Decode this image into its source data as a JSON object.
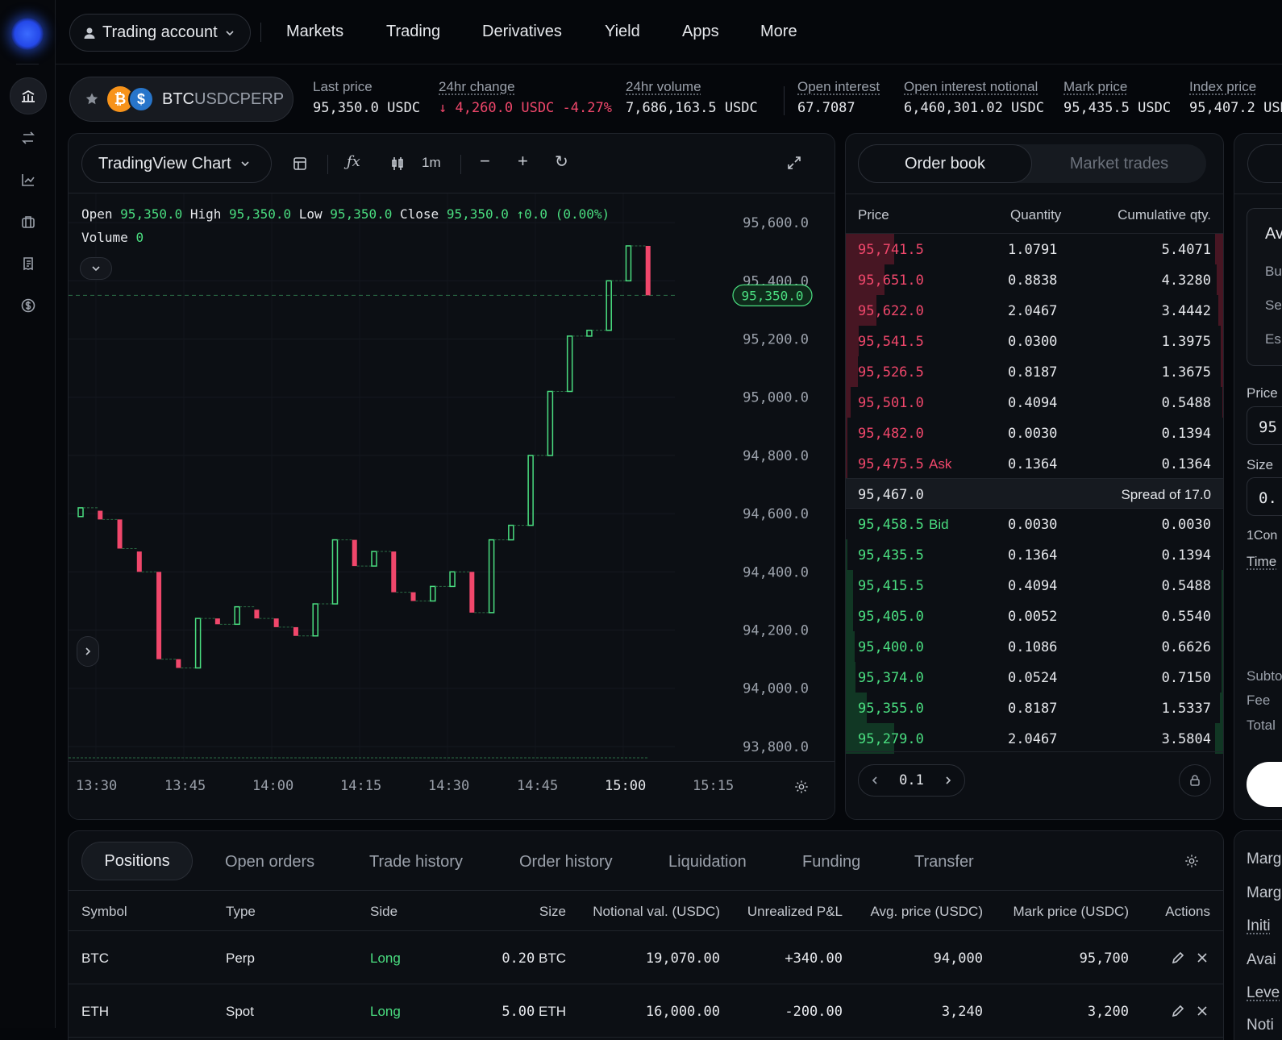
{
  "sidebar": {
    "icons": [
      "home-chart-icon",
      "swap-icon",
      "trend-icon",
      "briefcase-icon",
      "receipt-icon",
      "dollar-icon"
    ]
  },
  "nav": {
    "account": "Trading account",
    "items": [
      "Markets",
      "Trading",
      "Derivatives",
      "Yield",
      "Apps",
      "More"
    ]
  },
  "ticker": {
    "symbol_base": "BTC",
    "symbol_quote": "USDCPERP",
    "stats": [
      {
        "label": "Last price",
        "value": "95,350.0 USDC",
        "underline": false
      },
      {
        "label": "24hr change",
        "value": "↓ 4,260.0 USDC  -4.27%",
        "underline": true
      },
      {
        "label": "24hr volume",
        "value": "7,686,163.5 USDC",
        "underline": true
      },
      {
        "label": "Open interest",
        "value": "67.7087",
        "underline": true
      },
      {
        "label": "Open interest notional",
        "value": "6,460,301.02 USDC",
        "underline": true
      },
      {
        "label": "Mark price",
        "value": "95,435.5 USDC",
        "underline": true
      },
      {
        "label": "Index price",
        "value": "95,407.2 USDC",
        "underline": true
      }
    ]
  },
  "chart": {
    "selector": "TradingView Chart",
    "interval": "1m",
    "ohlc": {
      "open_label": "Open",
      "open": "95,350.0",
      "high_label": "High",
      "high": "95,350.0",
      "low_label": "Low",
      "low": "95,350.0",
      "close_label": "Close",
      "close": "95,350.0",
      "change": "↑0.0 (0.00%)"
    },
    "volume_label": "Volume",
    "volume": "0",
    "current_price_tag": "95,350.0",
    "time_labels": [
      "13:30",
      "13:45",
      "14:00",
      "14:15",
      "14:30",
      "14:45",
      "15:00",
      "15:15"
    ],
    "price_labels": [
      "95,600.0",
      "95,400.0",
      "95,200.0",
      "95,000.0",
      "94,800.0",
      "94,600.0",
      "94,400.0",
      "94,200.0",
      "94,000.0",
      "93,800.0"
    ]
  },
  "chart_data": {
    "type": "candlestick",
    "ylim": [
      93750,
      95700
    ],
    "current_price": 95350,
    "candles": [
      {
        "o": 94590,
        "c": 94620,
        "up": true
      },
      {
        "o": 94610,
        "c": 94580,
        "up": false
      },
      {
        "o": 94580,
        "c": 94480,
        "up": false
      },
      {
        "o": 94470,
        "c": 94400,
        "up": false
      },
      {
        "o": 94400,
        "c": 94100,
        "up": false
      },
      {
        "o": 94100,
        "c": 94070,
        "up": false
      },
      {
        "o": 94070,
        "c": 94240,
        "up": true
      },
      {
        "o": 94240,
        "c": 94220,
        "up": false
      },
      {
        "o": 94220,
        "c": 94280,
        "up": true
      },
      {
        "o": 94270,
        "c": 94240,
        "up": false
      },
      {
        "o": 94240,
        "c": 94210,
        "up": false
      },
      {
        "o": 94210,
        "c": 94180,
        "up": false
      },
      {
        "o": 94180,
        "c": 94290,
        "up": true
      },
      {
        "o": 94290,
        "c": 94510,
        "up": true
      },
      {
        "o": 94510,
        "c": 94420,
        "up": false
      },
      {
        "o": 94420,
        "c": 94470,
        "up": true
      },
      {
        "o": 94470,
        "c": 94330,
        "up": false
      },
      {
        "o": 94330,
        "c": 94300,
        "up": false
      },
      {
        "o": 94300,
        "c": 94350,
        "up": true
      },
      {
        "o": 94350,
        "c": 94400,
        "up": true
      },
      {
        "o": 94400,
        "c": 94260,
        "up": false
      },
      {
        "o": 94260,
        "c": 94510,
        "up": true
      },
      {
        "o": 94510,
        "c": 94560,
        "up": true
      },
      {
        "o": 94560,
        "c": 94800,
        "up": true
      },
      {
        "o": 94800,
        "c": 95020,
        "up": true
      },
      {
        "o": 95020,
        "c": 95210,
        "up": true
      },
      {
        "o": 95210,
        "c": 95230,
        "up": true
      },
      {
        "o": 95230,
        "c": 95400,
        "up": true
      },
      {
        "o": 95400,
        "c": 95520,
        "up": true
      },
      {
        "o": 95520,
        "c": 95350,
        "up": false
      }
    ],
    "volumes": [
      0,
      0,
      0,
      0,
      0,
      0,
      0,
      0,
      0,
      0,
      0,
      0,
      0,
      0,
      0,
      0,
      0,
      0,
      0,
      0,
      0,
      0,
      0,
      0,
      0,
      0,
      0,
      0,
      0,
      0
    ]
  },
  "orderbook": {
    "tab_active": "Order book",
    "tab_inactive": "Market trades",
    "headers": [
      "Price",
      "Quantity",
      "Cumulative qty."
    ],
    "asks": [
      {
        "price": "95,741.5",
        "qty": "1.0791",
        "cum": "5.4071",
        "depth": 1.0
      },
      {
        "price": "95,651.0",
        "qty": "0.8838",
        "cum": "4.3280",
        "depth": 0.8
      },
      {
        "price": "95,622.0",
        "qty": "2.0467",
        "cum": "3.4442",
        "depth": 0.64
      },
      {
        "price": "95,541.5",
        "qty": "0.0300",
        "cum": "1.3975",
        "depth": 0.26
      },
      {
        "price": "95,526.5",
        "qty": "0.8187",
        "cum": "1.3675",
        "depth": 0.25
      },
      {
        "price": "95,501.0",
        "qty": "0.4094",
        "cum": "0.5488",
        "depth": 0.1
      },
      {
        "price": "95,482.0",
        "qty": "0.0030",
        "cum": "0.1394",
        "depth": 0.03
      },
      {
        "price": "95,475.5",
        "qty": "0.1364",
        "cum": "0.1364",
        "depth": 0.03,
        "tag": "Ask"
      }
    ],
    "mid_price": "95,467.0",
    "spread": "Spread of 17.0",
    "bids": [
      {
        "price": "95,458.5",
        "qty": "0.0030",
        "cum": "0.0030",
        "depth": 0.0,
        "tag": "Bid"
      },
      {
        "price": "95,435.5",
        "qty": "0.1364",
        "cum": "0.1394",
        "depth": 0.04
      },
      {
        "price": "95,415.5",
        "qty": "0.4094",
        "cum": "0.5488",
        "depth": 0.15
      },
      {
        "price": "95,405.0",
        "qty": "0.0052",
        "cum": "0.5540",
        "depth": 0.15
      },
      {
        "price": "95,400.0",
        "qty": "0.1086",
        "cum": "0.6626",
        "depth": 0.19
      },
      {
        "price": "95,374.0",
        "qty": "0.0524",
        "cum": "0.7150",
        "depth": 0.2
      },
      {
        "price": "95,355.0",
        "qty": "0.8187",
        "cum": "1.5337",
        "depth": 0.43
      },
      {
        "price": "95,279.0",
        "qty": "2.0467",
        "cum": "3.5804",
        "depth": 1.0
      }
    ],
    "step": "0.1"
  },
  "orderform": {
    "header_fragment": "Av",
    "rows": [
      "Bu",
      "Se",
      "Es"
    ],
    "price_label": "Price",
    "price_value": "95",
    "size_label": "Size",
    "size_value": "0.",
    "contract_label": "1Con",
    "time_label": "Time",
    "subtotal_label": "Subto",
    "fee_label": "Fee",
    "total_label": "Total"
  },
  "positions": {
    "tabs": [
      "Positions",
      "Open orders",
      "Trade history",
      "Order history",
      "Liquidation",
      "Funding",
      "Transfer"
    ],
    "headers": [
      "Symbol",
      "Type",
      "Side",
      "Size",
      "Notional val. (USDC)",
      "Unrealized P&L",
      "Avg. price (USDC)",
      "Mark price (USDC)",
      "Actions"
    ],
    "rows": [
      {
        "symbol": "BTC",
        "type": "Perp",
        "side": "Long",
        "size": "0.20",
        "size_unit": "BTC",
        "notional": "19,070.00",
        "pnl": "+340.00",
        "avg": "94,000",
        "mark": "95,700"
      },
      {
        "symbol": "ETH",
        "type": "Spot",
        "side": "Long",
        "size": "5.00",
        "size_unit": "ETH",
        "notional": "16,000.00",
        "pnl": "-200.00",
        "avg": "3,240",
        "mark": "3,200"
      }
    ]
  },
  "margin": {
    "rows": [
      "Marg",
      "Marg",
      "Initi",
      "Avai",
      "Leve",
      "Noti"
    ]
  }
}
